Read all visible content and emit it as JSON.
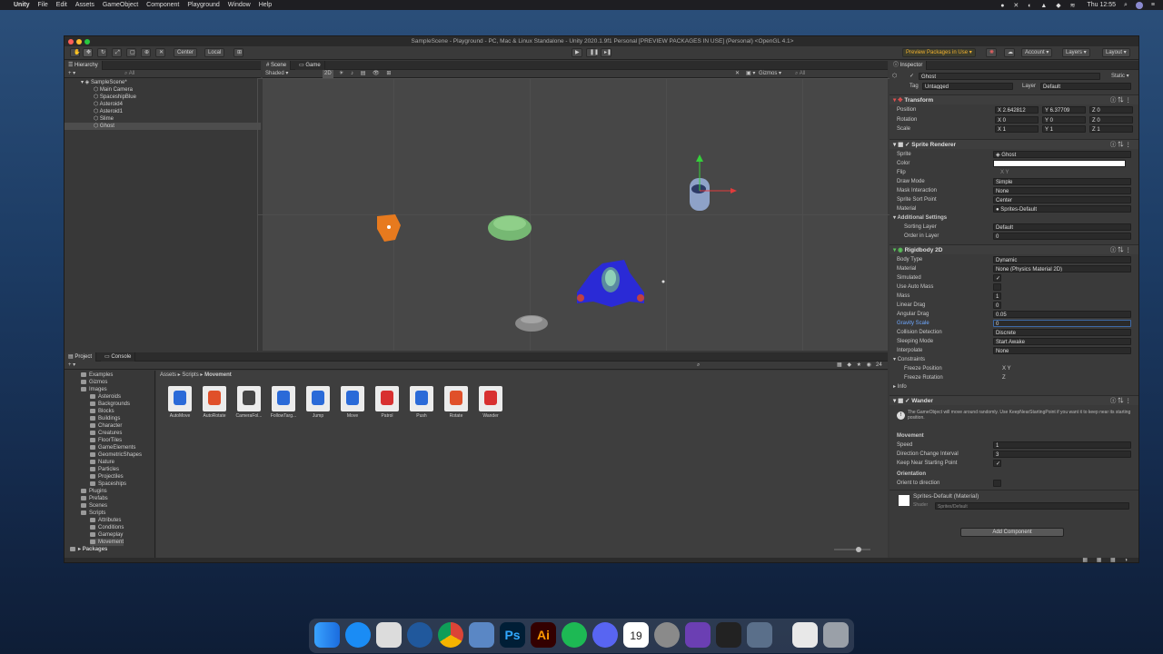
{
  "menubar": {
    "items": [
      "Unity",
      "File",
      "Edit",
      "Assets",
      "GameObject",
      "Component",
      "Playground",
      "Window",
      "Help"
    ],
    "clock": "Thu 12:55"
  },
  "window": {
    "title": "SampleScene - Playground - PC, Mac & Linux Standalone - Unity 2020.1.9f1 Personal [PREVIEW PACKAGES IN USE] (Personal) <OpenGL 4.1>"
  },
  "toolbar": {
    "center": "Center",
    "local": "Local",
    "preview": "Preview Packages in Use",
    "account": "Account",
    "layers": "Layers",
    "layout": "Layout"
  },
  "hierarchy": {
    "tab": "Hierarchy",
    "search": "All",
    "root": "SampleScene*",
    "items": [
      "Main Camera",
      "SpaceshipBlue",
      "Asteroid4",
      "Asteroid1",
      "Slime",
      "Ghost"
    ]
  },
  "scene": {
    "tab_scene": "Scene",
    "tab_game": "Game",
    "shading": "Shaded",
    "mode2d": "2D",
    "gizmos": "Gizmos",
    "search": "All"
  },
  "inspector": {
    "tab": "Inspector",
    "name": "Ghost",
    "static": "Static",
    "tag_label": "Tag",
    "tag": "Untagged",
    "layer_label": "Layer",
    "layer": "Default",
    "transform": {
      "title": "Transform",
      "position_label": "Position",
      "rotation_label": "Rotation",
      "scale_label": "Scale",
      "px": "2.642812",
      "py": "6.37709",
      "pz": "0",
      "rx": "0",
      "ry": "0",
      "rz": "0",
      "sx": "1",
      "sy": "1",
      "sz": "1"
    },
    "sprite_renderer": {
      "title": "Sprite Renderer",
      "rows": [
        [
          "Sprite",
          "Ghost"
        ],
        [
          "Color",
          ""
        ],
        [
          "Flip",
          "X  Y"
        ],
        [
          "Draw Mode",
          "Simple"
        ],
        [
          "Mask Interaction",
          "None"
        ],
        [
          "Sprite Sort Point",
          "Center"
        ],
        [
          "Material",
          "Sprites-Default"
        ]
      ],
      "additional": "Additional Settings",
      "sorting_layer_label": "Sorting Layer",
      "sorting_layer": "Default",
      "order_label": "Order in Layer",
      "order": "0"
    },
    "rigidbody": {
      "title": "Rigidbody 2D",
      "rows": [
        [
          "Body Type",
          "Dynamic"
        ],
        [
          "Material",
          "None (Physics Material 2D)"
        ],
        [
          "Simulated",
          "✓"
        ],
        [
          "Use Auto Mass",
          ""
        ],
        [
          "Mass",
          "1"
        ],
        [
          "Linear Drag",
          "0"
        ],
        [
          "Angular Drag",
          "0.05"
        ],
        [
          "Gravity Scale",
          "0"
        ],
        [
          "Collision Detection",
          "Discrete"
        ],
        [
          "Sleeping Mode",
          "Start Awake"
        ],
        [
          "Interpolate",
          "None"
        ]
      ],
      "constraints": "Constraints",
      "freeze_pos_label": "Freeze Position",
      "freeze_pos": "X  Y",
      "freeze_rot_label": "Freeze Rotation",
      "freeze_rot": "Z",
      "info": "Info"
    },
    "wander": {
      "title": "Wander",
      "help": "The GameObject will move around randomly. Use KeepNearStartingPoint if you want it to keep near its starting position.",
      "movement": "Movement",
      "speed_label": "Speed",
      "speed": "1",
      "dci_label": "Direction Change Interval",
      "dci": "3",
      "keep_label": "Keep Near Starting Point",
      "keep": "✓",
      "orientation": "Orientation",
      "orient_label": "Orient to direction"
    },
    "material": {
      "name": "Sprites-Default (Material)",
      "shader_label": "Shader",
      "shader": "Sprites/Default"
    },
    "add_component": "Add Component"
  },
  "project": {
    "tab_project": "Project",
    "tab_console": "Console",
    "breadcrumb": [
      "Assets",
      "Scripts",
      "Movement"
    ],
    "count": "24",
    "folders": [
      [
        "Examples",
        1
      ],
      [
        "Gizmos",
        1
      ],
      [
        "Images",
        1
      ],
      [
        "Asteroids",
        2
      ],
      [
        "Backgrounds",
        2
      ],
      [
        "Blocks",
        2
      ],
      [
        "Buildings",
        2
      ],
      [
        "Character",
        2
      ],
      [
        "Creatures",
        2
      ],
      [
        "FloorTiles",
        2
      ],
      [
        "GameElements",
        2
      ],
      [
        "GeometricShapes",
        2
      ],
      [
        "Nature",
        2
      ],
      [
        "Particles",
        2
      ],
      [
        "Projectiles",
        2
      ],
      [
        "Spaceships",
        2
      ],
      [
        "Plugins",
        1
      ],
      [
        "Prefabs",
        1
      ],
      [
        "Scenes",
        1
      ],
      [
        "Scripts",
        1
      ],
      [
        "Attributes",
        2
      ],
      [
        "Conditions",
        2
      ],
      [
        "Gameplay",
        2
      ],
      [
        "Movement",
        2
      ]
    ],
    "packages": "Packages",
    "assets": [
      "AutoMove",
      "AutoRotate",
      "CameraFol...",
      "FollowTarg...",
      "Jump",
      "Move",
      "Patrol",
      "Push",
      "Rotate",
      "Wander"
    ]
  },
  "colors": {
    "accent": "#3d6aa8",
    "window_bg": "#383838",
    "scene_bg": "#474747"
  }
}
